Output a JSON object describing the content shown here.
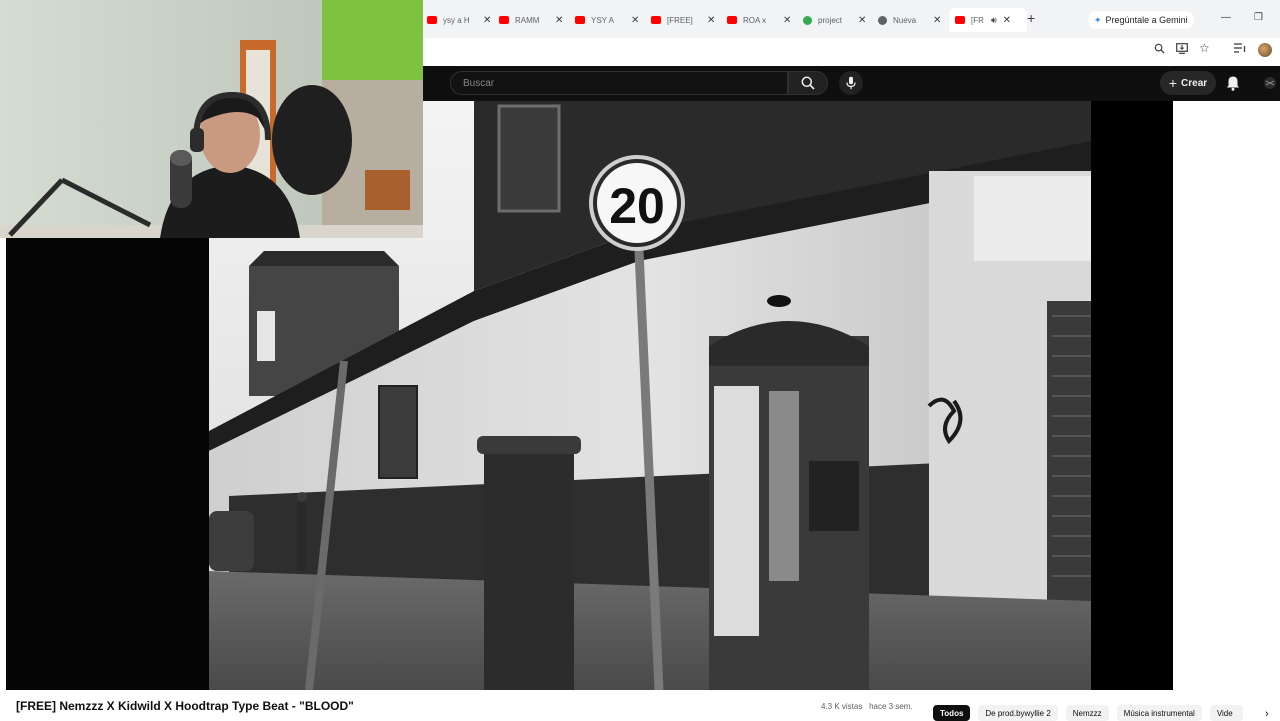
{
  "browser": {
    "tabs": [
      {
        "title": "ysy a H",
        "favicon_color": "#ff0000"
      },
      {
        "title": "RAMM",
        "favicon_color": "#ff0000"
      },
      {
        "title": "YSY A",
        "favicon_color": "#ff0000"
      },
      {
        "title": "[FREE]",
        "favicon_color": "#ff0000"
      },
      {
        "title": "ROA x",
        "favicon_color": "#ff0000"
      },
      {
        "title": "project",
        "favicon_color": "#34a853"
      },
      {
        "title": "Nueva",
        "favicon_color": "#5f6368"
      },
      {
        "title": "[FR",
        "favicon_color": "#ff0000",
        "active": true
      }
    ],
    "gemini_label": "Pregúntale a Gemini"
  },
  "youtube": {
    "search_placeholder": "Buscar",
    "create_label": "Crear"
  },
  "video": {
    "sign_number": "20",
    "title": "[FREE] Nemzzz X Kidwild X Hoodtrap Type Beat - \"BLOOD\"",
    "views": "4.3 K vistas",
    "age": "hace 3 sem."
  },
  "chips": [
    "Todos",
    "De prod.bywyllie 2",
    "Nemzzz",
    "Música instrumental",
    "Vide"
  ],
  "colors": {
    "youtube_red": "#ff0000",
    "header_bg": "#0f0f0f"
  }
}
